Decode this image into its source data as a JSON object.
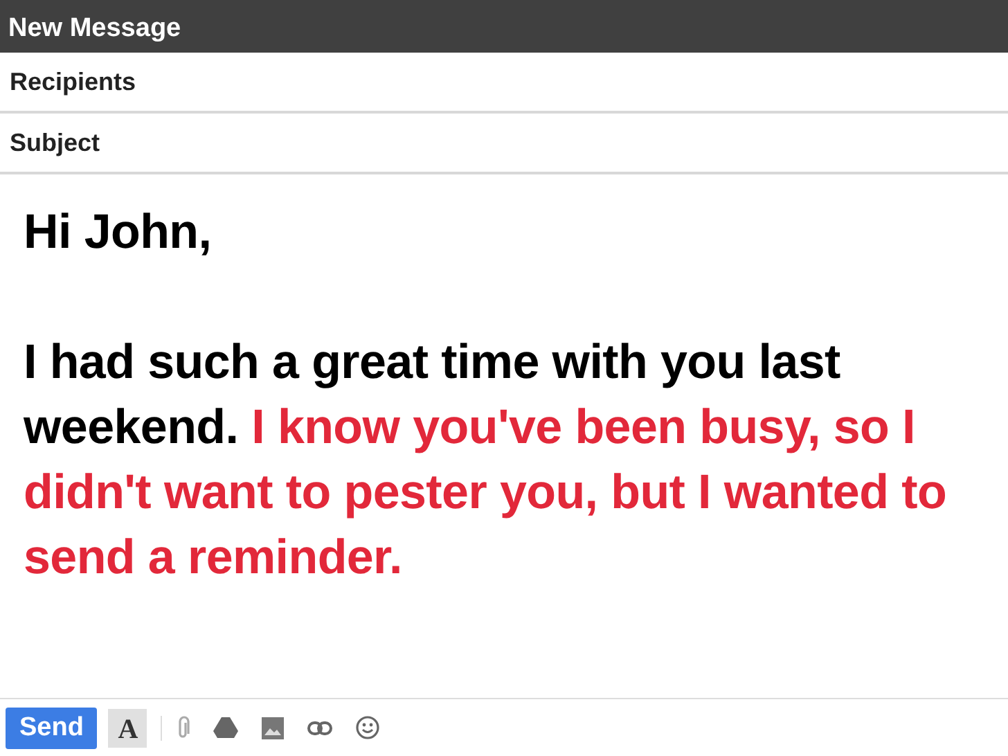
{
  "window": {
    "title": "New Message"
  },
  "fields": [
    {
      "placeholder": "Recipients"
    },
    {
      "placeholder": "Subject"
    }
  ],
  "body": {
    "greeting": "Hi John,",
    "paragraph": [
      {
        "text": "I had such a great time with you last weekend. ",
        "highlighted": false
      },
      {
        "text": "I know you've been busy, so I didn't want to pester you, but I wanted to send a reminder.",
        "highlighted": true
      }
    ]
  },
  "toolbar": {
    "send_label": "Send",
    "format_label": "A",
    "format_selected": true
  }
}
